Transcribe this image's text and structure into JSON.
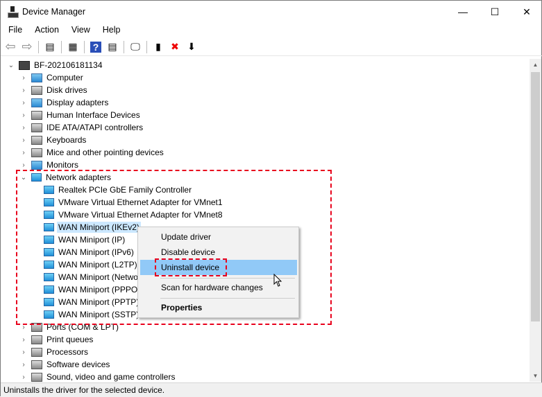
{
  "window": {
    "title": "Device Manager",
    "minimize": "—",
    "maximize": "☐",
    "close": "✕"
  },
  "menu": [
    "File",
    "Action",
    "View",
    "Help"
  ],
  "toolbar": [
    {
      "icon": "back-icon",
      "g": "⇦"
    },
    {
      "icon": "forward-icon",
      "g": "⇨"
    },
    {
      "icon": "show-hide-console-tree-icon",
      "g": "▤"
    },
    {
      "icon": "properties-icon",
      "g": "▦"
    },
    {
      "icon": "help-icon",
      "g": "?"
    },
    {
      "icon": "action-pane-icon",
      "g": "▤"
    },
    {
      "icon": "scan-hardware-icon",
      "g": "🖵"
    },
    {
      "icon": "update-driver-icon",
      "g": "▮"
    },
    {
      "icon": "uninstall-icon",
      "g": "✖"
    },
    {
      "icon": "download-icon",
      "g": "⬇"
    }
  ],
  "tree": {
    "root": "BF-202106181134",
    "categories_before": [
      "Computer",
      "Disk drives",
      "Display adapters",
      "Human Interface Devices",
      "IDE ATA/ATAPI controllers",
      "Keyboards",
      "Mice and other pointing devices",
      "Monitors"
    ],
    "network": {
      "label": "Network adapters",
      "children": [
        "Realtek PCIe GbE Family Controller",
        "VMware Virtual Ethernet Adapter for VMnet1",
        "VMware Virtual Ethernet Adapter for VMnet8",
        "WAN Miniport (IKEv2)",
        "WAN Miniport (IP)",
        "WAN Miniport (IPv6)",
        "WAN Miniport (L2TP)",
        "WAN Miniport (Network Monitor)",
        "WAN Miniport (PPPOE)",
        "WAN Miniport (PPTP)",
        "WAN Miniport (SSTP)"
      ],
      "selected_index": 3
    },
    "categories_after": [
      "Ports (COM & LPT)",
      "Print queues",
      "Processors",
      "Software devices",
      "Sound, video and game controllers"
    ]
  },
  "context_menu": {
    "items": [
      "Update driver",
      "Disable device",
      "Uninstall device",
      "Scan for hardware changes",
      "Properties"
    ],
    "highlighted_index": 2
  },
  "status_bar": "Uninstalls the driver for the selected device.",
  "colors": {
    "highlight": "#91c9f7",
    "annotation": "#e8001c",
    "selection": "#cce8ff"
  }
}
